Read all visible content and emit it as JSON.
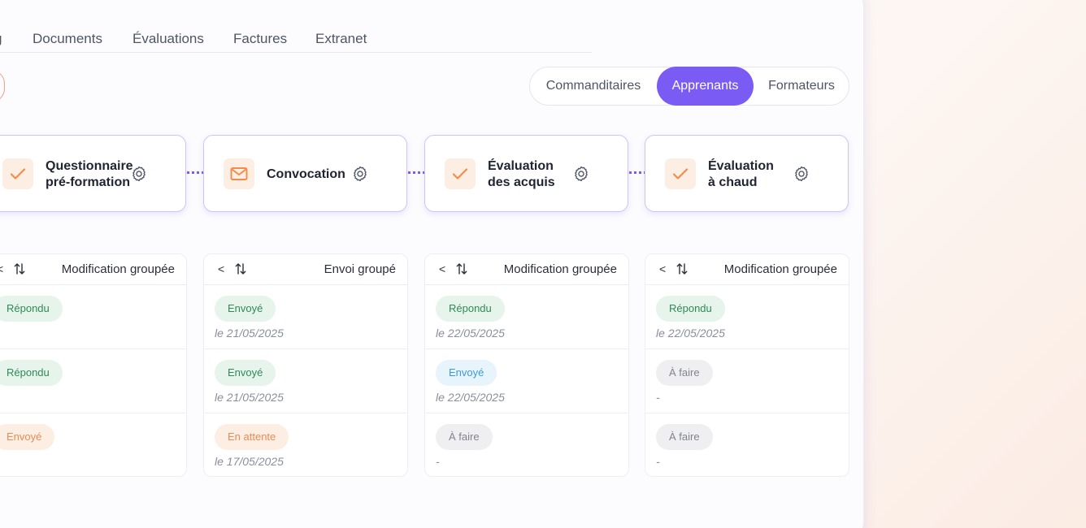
{
  "tabs": [
    "g",
    "Documents",
    "Évaluations",
    "Factures",
    "Extranet"
  ],
  "segment": {
    "options": [
      "Commanditaires",
      "Apprenants",
      "Formateurs"
    ],
    "active": "Apprenants"
  },
  "steps": [
    {
      "lines": [
        "Questionnaire",
        "pré-formation"
      ],
      "icon": "check-icon"
    },
    {
      "lines": [
        "Convocation"
      ],
      "icon": "mail-icon"
    },
    {
      "lines": [
        "Évaluation",
        "des acquis"
      ],
      "icon": "check-icon"
    },
    {
      "lines": [
        "Évaluation",
        "à chaud"
      ],
      "icon": "check-icon"
    }
  ],
  "columns": [
    {
      "chevron": "<",
      "action": "Modification groupée",
      "rows": [
        {
          "status": "Répondu",
          "tone": "s-repondu",
          "date": ""
        },
        {
          "status": "Répondu",
          "tone": "s-repondu",
          "date": ""
        },
        {
          "status": "Envoyé",
          "tone": "s-envoye-orange",
          "date": ""
        }
      ]
    },
    {
      "chevron": "<",
      "action": "Envoi groupé",
      "rows": [
        {
          "status": "Envoyé",
          "tone": "s-envoye-green",
          "date": "le 21/05/2025"
        },
        {
          "status": "Envoyé",
          "tone": "s-envoye-green",
          "date": "le 21/05/2025"
        },
        {
          "status": "En attente",
          "tone": "s-attente",
          "date": "le 17/05/2025"
        }
      ]
    },
    {
      "chevron": "<",
      "action": "Modification groupée",
      "rows": [
        {
          "status": "Répondu",
          "tone": "s-repondu",
          "date": "le 22/05/2025"
        },
        {
          "status": "Envoyé",
          "tone": "s-envoye-blue",
          "date": "le 22/05/2025"
        },
        {
          "status": "À faire",
          "tone": "s-afaire",
          "date": "-"
        }
      ]
    },
    {
      "chevron": "<",
      "action": "Modification groupée",
      "rows": [
        {
          "status": "Répondu",
          "tone": "s-repondu",
          "date": "le 22/05/2025"
        },
        {
          "status": "À faire",
          "tone": "s-afaire",
          "date": " -"
        },
        {
          "status": "À faire",
          "tone": "s-afaire",
          "date": "-"
        }
      ]
    }
  ],
  "colors": {
    "accent": "#7a5cf5",
    "icon_orange": "#f28c4b"
  }
}
